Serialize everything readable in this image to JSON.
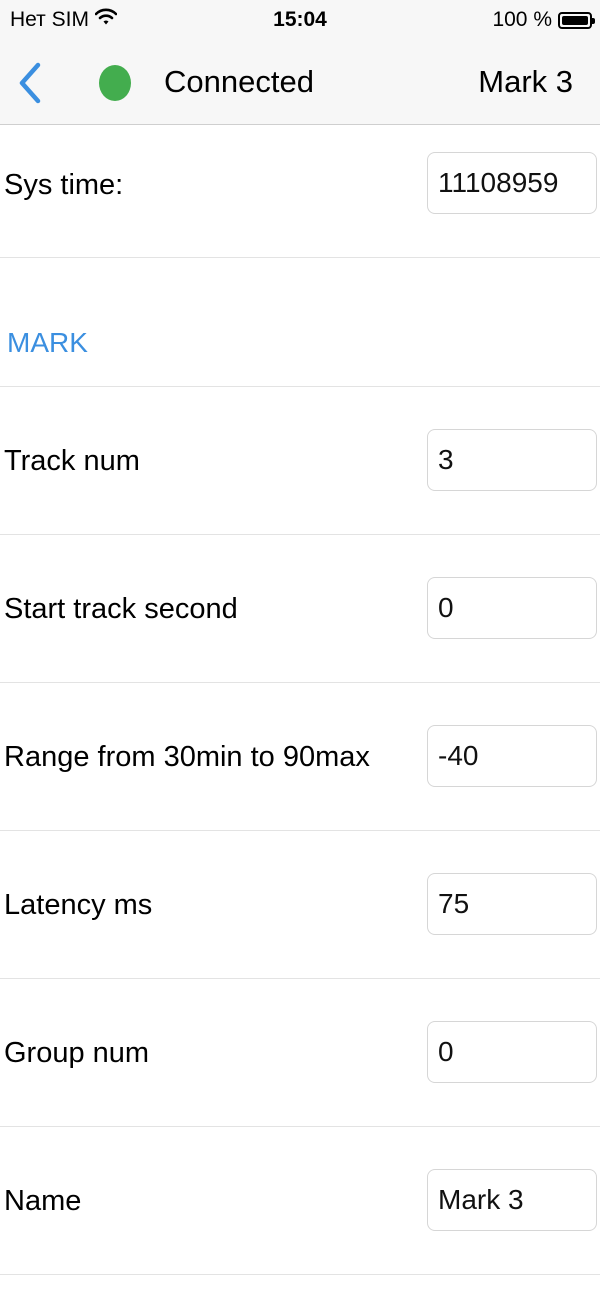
{
  "status_bar": {
    "carrier": "Нет SIM",
    "time": "15:04",
    "battery_text": "100 %",
    "battery_level": 1.0
  },
  "nav": {
    "back_icon": "chevron-left-icon",
    "connection_status": "Connected",
    "connection_color": "#43ad4e",
    "title": "Mark 3",
    "accent_color": "#3b8fe0"
  },
  "sys_time": {
    "label": "Sys time:",
    "value": "11108959"
  },
  "section": {
    "title": "MARK"
  },
  "fields": [
    {
      "label": "Track num",
      "value": "3"
    },
    {
      "label": "Start track second",
      "value": "0"
    },
    {
      "label": "Range from 30min to 90max",
      "value": "-40"
    },
    {
      "label": "Latency ms",
      "value": "75"
    },
    {
      "label": "Group num",
      "value": "0"
    },
    {
      "label": "Name",
      "value": "Mark 3"
    }
  ]
}
